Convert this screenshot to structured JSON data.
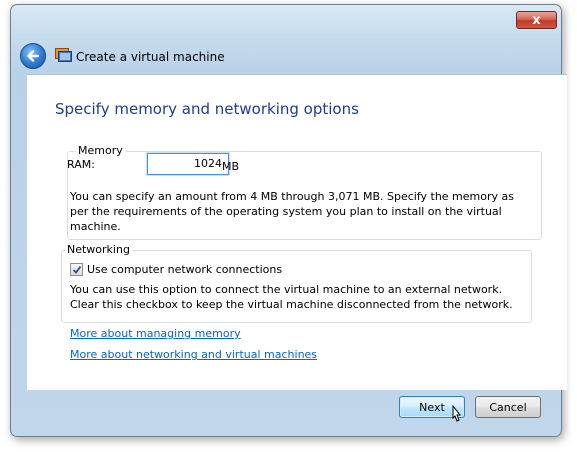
{
  "window": {
    "title": "Create a virtual machine",
    "close_glyph": "x",
    "accent_color": "#1e3d8f",
    "link_color": "#0066cc"
  },
  "page": {
    "heading": "Specify memory and networking options"
  },
  "memory": {
    "group_label": "Memory",
    "ram_label": "RAM:",
    "ram_value": "1024",
    "unit": "MB",
    "description": "You can specify an amount from 4 MB through 3,071 MB. Specify the memory as per the requirements of the operating system you plan to install on the virtual machine."
  },
  "networking": {
    "group_label": "Networking",
    "checkbox_label": "Use computer network connections",
    "checkbox_checked": true,
    "description": "You can use this option to connect the virtual machine to an external network. Clear this checkbox to keep the virtual machine disconnected from the network."
  },
  "links": {
    "memory": "More about managing memory",
    "networking": "More about networking and virtual machines"
  },
  "footer": {
    "next_label": "Next",
    "cancel_label": "Cancel"
  },
  "icons": {
    "back": "back-arrow-icon",
    "app": "virtual-machine-icon",
    "cursor": "mouse-pointer-icon"
  }
}
